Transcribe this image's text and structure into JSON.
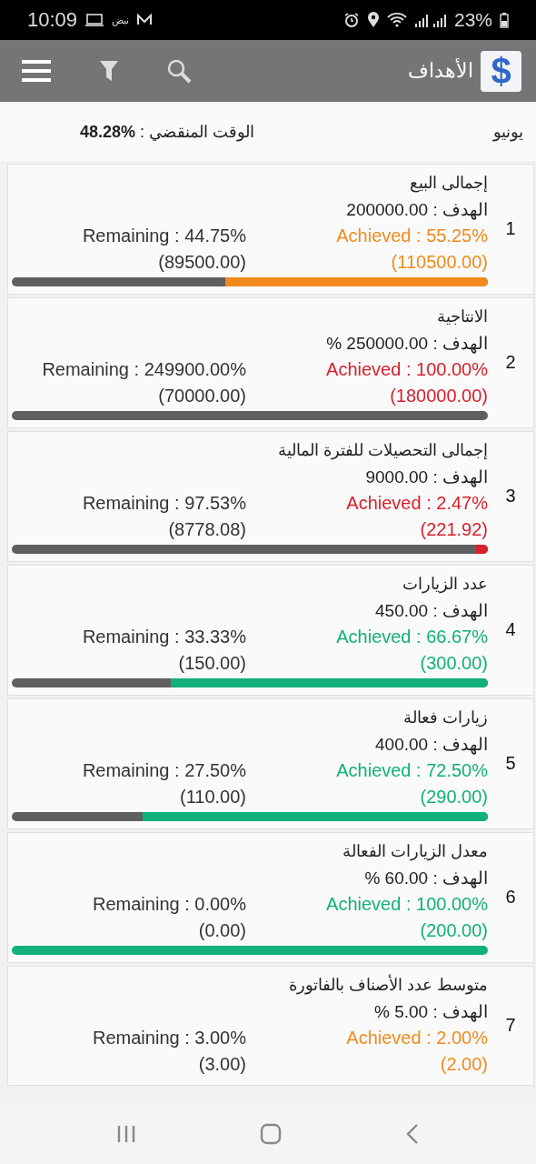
{
  "status_bar": {
    "time": "10:09",
    "carrier_text": "نبض",
    "battery": "23%"
  },
  "app_bar": {
    "logo_text": "$",
    "title": "الأهداف"
  },
  "header": {
    "month": "يونيو",
    "elapsed": "الوقت المنقضي : **%48.28**"
  },
  "goals": [
    {
      "number": "1",
      "title": "إجمالى البيع",
      "target": "الهدف : 200000.00",
      "achieved": "Achieved : 55.25%",
      "achieved_value": "(110500.00)",
      "remaining": "Remaining : 44.75%",
      "remaining_value": "(89500.00)",
      "color": "#f08a1c",
      "progress_bar": true,
      "level": 0.5525
    },
    {
      "number": "2",
      "title": "الانتاجية",
      "target": "الهدف : 250000.00 %",
      "achieved": "Achieved : 100.00%",
      "achieved_value": "(180000.00)",
      "remaining": "Remaining : 249900.00%",
      "remaining_value": "(70000.00)",
      "color": "#d81f2a",
      "progress_bar": true
    },
    {
      "number": "3",
      "title": "إجمالى التحصيلات للفترة  المالية",
      "target": "الهدف : 9000.00",
      "achieved": "Achieved : 2.47%",
      "achieved_value": "(221.92)",
      "remaining": "Remaining : 97.53%",
      "remaining_value": "(8778.08)",
      "color": "#d81f2a",
      "progress_bar": true,
      "level": 0.0247
    },
    {
      "number": "4",
      "title": "عدد الزيارات",
      "target": "الهدف : 450.00",
      "achieved": "Achieved : 66.67%",
      "achieved_value": "(300.00)",
      "remaining": "Remaining : 33.33%",
      "remaining_value": "(150.00)",
      "color": "#12b07a",
      "progress_bar": true,
      "level": 0.6667
    },
    {
      "number": "5",
      "title": "زيارات فعالة",
      "target": "الهدف : 400.00",
      "achieved": "Achieved : 72.50%",
      "achieved_value": "(290.00)",
      "remaining": "Remaining : 27.50%",
      "remaining_value": "(110.00)",
      "color": "#12b07a",
      "progress_bar": true,
      "level": 0.725
    },
    {
      "number": "6",
      "title": "معدل الزيارات الفعالة",
      "target": "الهدف : 60.00 %",
      "achieved": "Achieved : 100.00%",
      "achieved_value": "(200.00)",
      "remaining": "Remaining : 0.00%",
      "remaining_value": "(0.00)",
      "color": "#12b07a",
      "progress_bar": true,
      "level": 1
    },
    {
      "number": "7",
      "title": "متوسط عدد الأصناف بالفاتورة",
      "target": "الهدف : 5.00 %",
      "achieved": "Achieved : 2.00%",
      "achieved_value": "(2.00)",
      "remaining": "Remaining : 3.00%",
      "remaining_value": "(3.00)",
      "color": "#f08a1c",
      "progress_bar": false
    }
  ]
}
